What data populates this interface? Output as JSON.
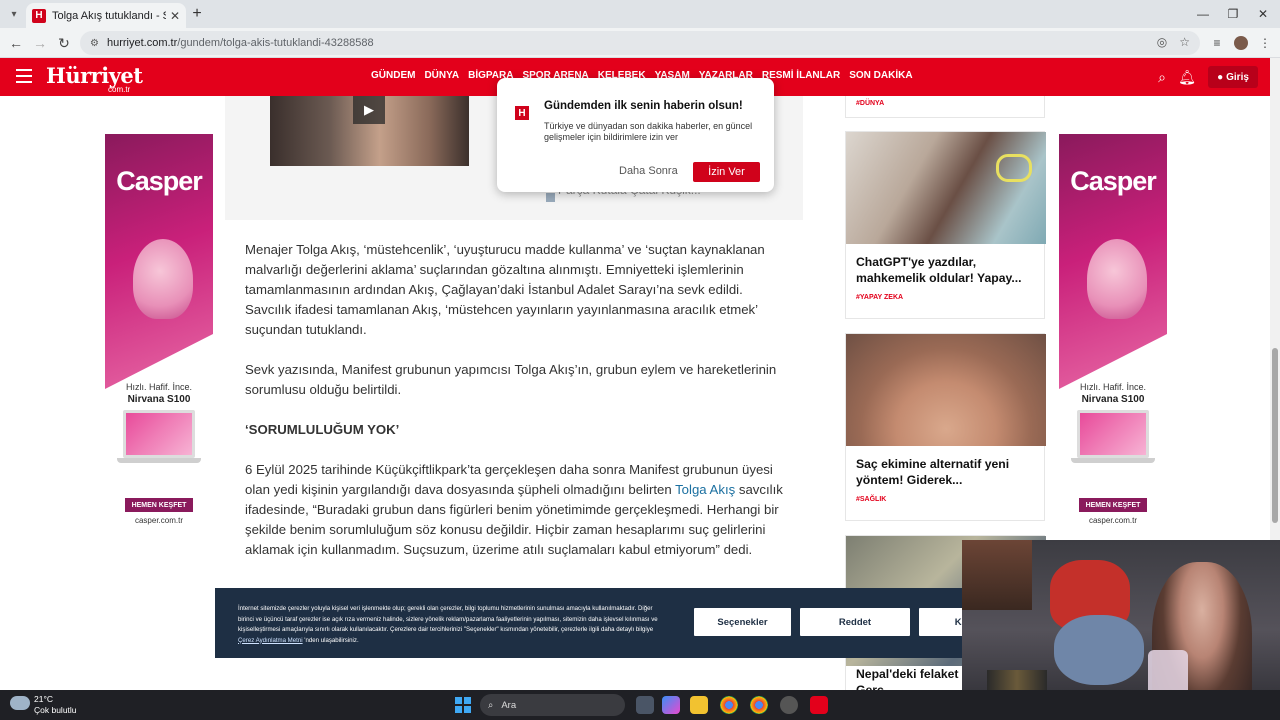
{
  "browser": {
    "tab_title": "Tolga Akış tutuklandı - Son Dakika",
    "tab_favicon": "H",
    "url_domain": "hurriyet.com.tr",
    "url_path": "/gundem/tolga-akis-tutuklandi-43288588"
  },
  "site": {
    "logo": "Hürriyet",
    "logo_sub": "com.tr",
    "nav": [
      "GÜNDEM",
      "DÜNYA",
      "BİGPARA",
      "SPOR ARENA",
      "KELEBEK",
      "YAŞAM",
      "YAZARLAR",
      "RESMİ İLANLAR",
      "SON DAKİKA"
    ],
    "login_label": "Giriş",
    "notif_count": "1",
    "brand_color": "#e3001b"
  },
  "notification": {
    "title": "Gündemden ilk senin haberin olsun!",
    "body": "Türkiye ve dünyadan son dakika haberler, en güncel gelişmeler için bildirimlere izin ver",
    "later_label": "Daha Sonra",
    "allow_label": "İzin Ver"
  },
  "embed": {
    "related_ghost": "Parça Kutala Çatal Kuşik..."
  },
  "article": {
    "p1": "Menajer Tolga Akış, ‘müstehcenlik’, ‘uyuşturucu madde kullanma’ ve ‘suçtan kaynaklanan malvarlığı değerlerini aklama’ suçlarından gözaltına alınmıştı. Emniyetteki işlemlerinin tamamlanmasının ardından Akış, Çağlayan’daki İstanbul Adalet Sarayı’na sevk edildi. Savcılık ifadesi tamamlanan Akış, ‘müstehcen yayınların yayınlanmasına aracılık etmek’ suçundan tutuklandı.",
    "p2": "Sevk yazısında, Manifest grubunun yapımcısı Tolga Akış’ın, grubun eylem ve hareketlerinin sorumlusu olduğu belirtildi.",
    "subhead": "‘SORUMLULUĞUM YOK’",
    "p3_before": "6 Eylül 2025 tarihinde Küçükçiftlikpark’ta gerçekleşen daha sonra Manifest grubunun üyesi olan yedi kişinin yargılandığı dava dosyasında şüpheli olmadığını belirten ",
    "p3_link": "Tolga Akış",
    "p3_after": " savcılık ifadesinde, “Buradaki grubun dans figürleri benim yönetimimde gerçekleşmedi. Herhangi bir şekilde benim sorumluluğum söz konusu değildir. Hiçbir zaman hesaplarımı suç gelirlerini aklamak için kullanmadım. Suçsuzum, üzerime atılı suçlamaları kabul etmiyorum” dedi."
  },
  "ads": {
    "brand": "Casper",
    "tagline": "Hızlı. Hafif. İnce.",
    "model": "Nirvana S100",
    "cta": "HEMEN KEŞFET",
    "url": "casper.com.tr"
  },
  "sidebar": {
    "prev_tag": "#DÜNYA",
    "cards": [
      {
        "title": "ChatGPT'ye yazdılar, mahkemelik oldular! Yapay...",
        "tag": "#YAPAY ZEKA"
      },
      {
        "title": "Saç ekimine alternatif yeni yöntem! Giderek...",
        "tag": "#SAĞLIK"
      },
      {
        "title": "Nepal'deki felaket kritik detay! Gerç..."
      }
    ]
  },
  "cookie": {
    "text_before": "İnternet sitemizde çerezler yoluyla kişisel veri işlenmekte olup; gerekli olan çerezler, bilgi toplumu hizmetlerinin sunulması amacıyla kullanılmaktadır. Diğer birinci ve üçüncü taraf çerezler ise açık rıza vermeniz halinde, sizlere yönelik reklam/pazarlama faaliyetlerinin yapılması, sitemizin daha işlevsel kılınması ve kişiselleştirmesi amaçlarıyla sınırlı olarak kullanılacaktır. Çerezlere dair tercihlerinizi \"Seçenekler\" kısmından yönetebilir, çerezlerle ilgili daha detaylı bilgiye ",
    "link": "Çerez Aydınlatma Metni",
    "text_after": " 'nden ulaşabilirsiniz.",
    "options_label": "Seçenekler",
    "reject_label": "Reddet",
    "accept_label": "Kabul Et"
  },
  "taskbar": {
    "temperature": "21°C",
    "weather": "Çok bulutlu",
    "search_placeholder": "Ara"
  }
}
